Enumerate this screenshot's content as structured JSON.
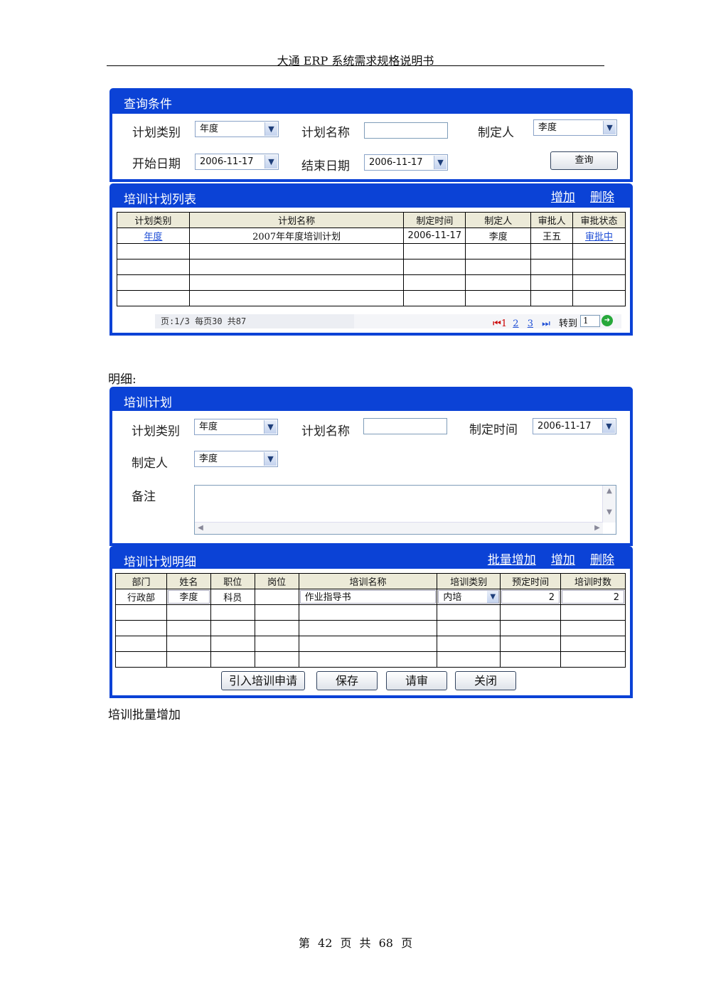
{
  "header": "大通 ERP 系统需求规格说明书",
  "footer": "第 42 页 共 68 页",
  "query_panel": {
    "title": "查询条件",
    "plan_type_label": "计划类别",
    "plan_type_value": "年度",
    "plan_name_label": "计划名称",
    "plan_name_value": "",
    "maker_label": "制定人",
    "maker_value": "李度",
    "start_date_label": "开始日期",
    "start_date_value": "2006-11-17",
    "end_date_label": "结束日期",
    "end_date_value": "2006-11-17",
    "query_button": "查询"
  },
  "list_panel": {
    "title": "培训计划列表",
    "add": "增加",
    "delete": "删除",
    "columns": [
      "计划类别",
      "计划名称",
      "制定时间",
      "制定人",
      "审批人",
      "审批状态"
    ],
    "rows": [
      {
        "type": "年度",
        "name": "2007年年度培训计划",
        "date": "2006-11-17",
        "maker": "李度",
        "approver": "王五",
        "status": "审批中"
      }
    ],
    "pager_info": "页:1/3 每页30 共87",
    "pages": [
      "1",
      "2",
      "3"
    ],
    "jump_label": "转到",
    "jump_value": "1"
  },
  "detail_label": "明细:",
  "plan_panel": {
    "title": "培训计划",
    "plan_type_label": "计划类别",
    "plan_type_value": "年度",
    "plan_name_label": "计划名称",
    "plan_name_value": "",
    "make_time_label": "制定时间",
    "make_time_value": "2006-11-17",
    "maker_label": "制定人",
    "maker_value": "李度",
    "remark_label": "备注"
  },
  "detail_panel": {
    "title": "培训计划明细",
    "batch_add": "批量增加",
    "add": "增加",
    "delete": "删除",
    "columns": [
      "部门",
      "姓名",
      "职位",
      "岗位",
      "培训名称",
      "培训类别",
      "预定时间",
      "培训时数"
    ],
    "rows": [
      {
        "dept": "行政部",
        "name": "李度",
        "position": "科员",
        "post": "",
        "training": "作业指导书",
        "category": "内培",
        "planned": "2",
        "hours": "2"
      }
    ],
    "buttons": {
      "import": "引入培训申请",
      "save": "保存",
      "submit": "请审",
      "close": "关闭"
    }
  },
  "batch_label": "培训批量增加"
}
